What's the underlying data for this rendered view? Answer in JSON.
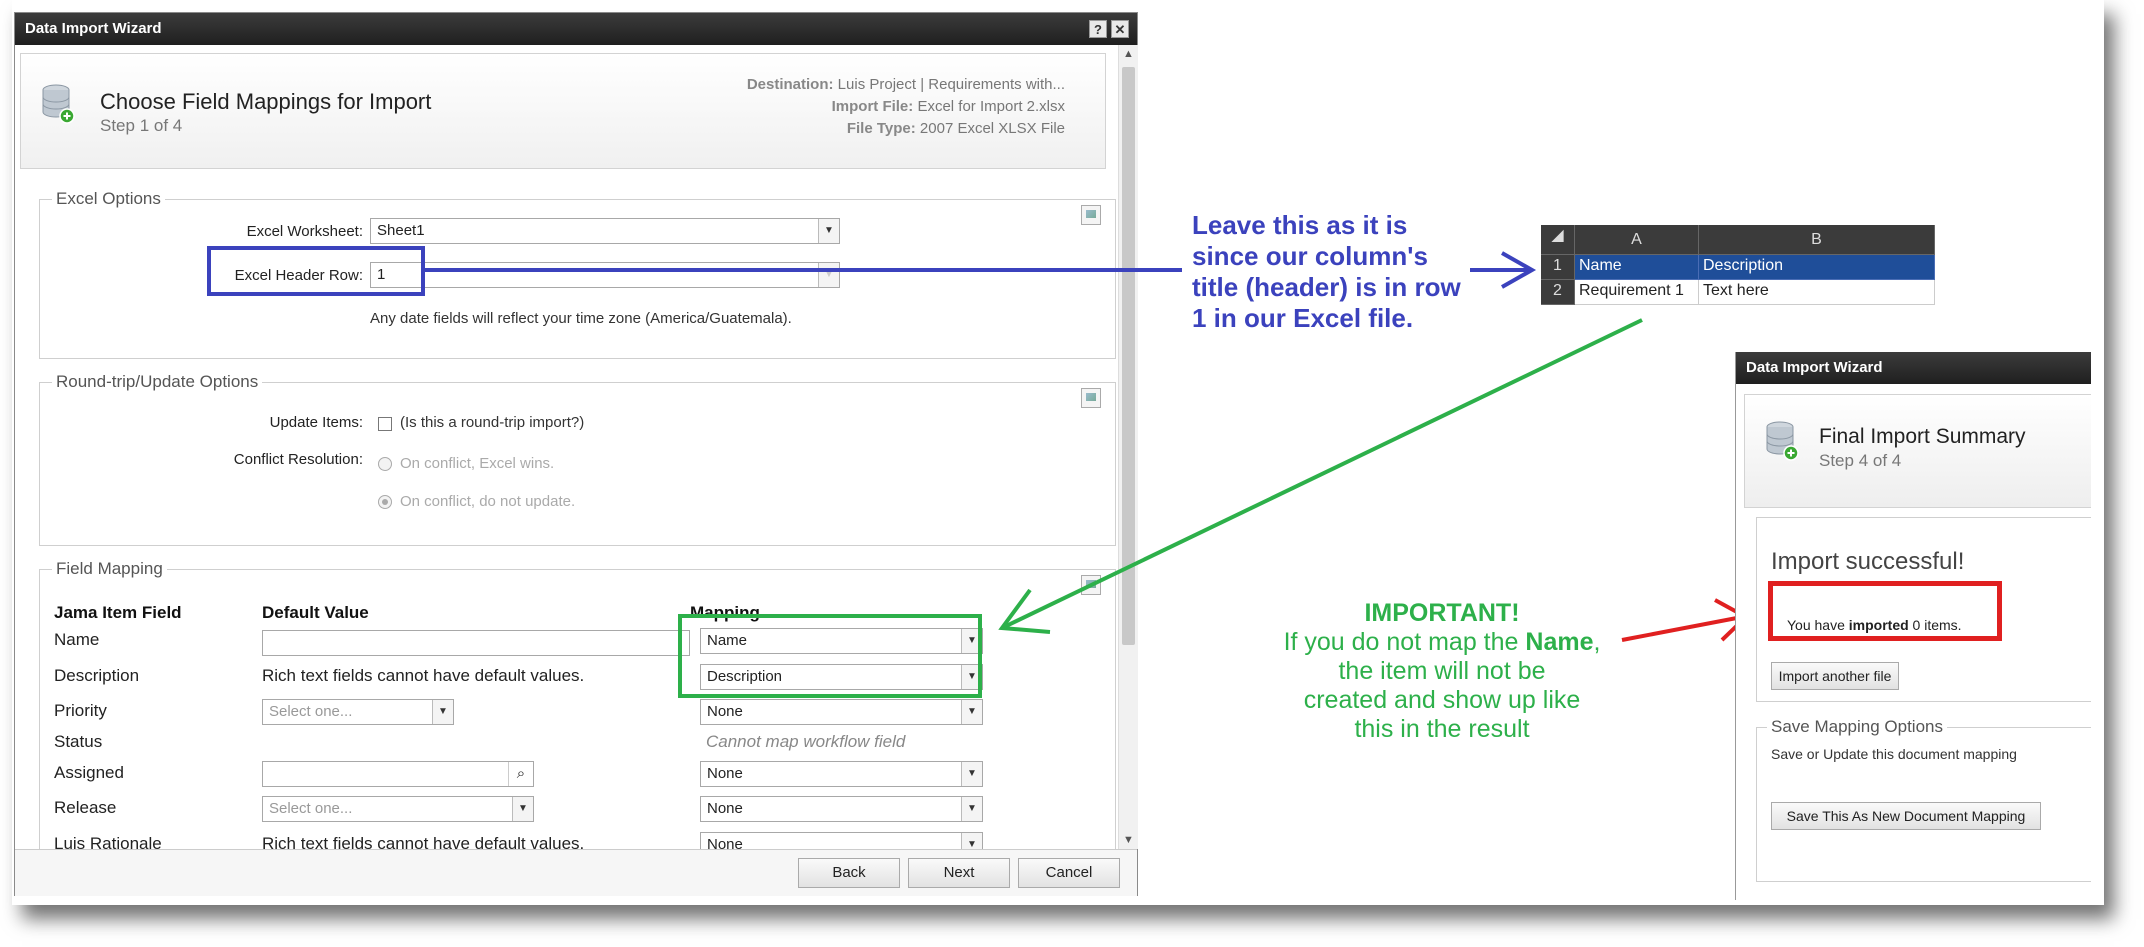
{
  "dialog": {
    "title": "Data Import Wizard",
    "help_label": "?",
    "close_label": "✕",
    "header": {
      "title": "Choose Field Mappings for Import",
      "step": "Step 1 of 4",
      "destination_label": "Destination:",
      "destination_value": "Luis Project | Requirements with...",
      "import_file_label": "Import File:",
      "import_file_value": "Excel for Import 2.xlsx",
      "file_type_label": "File Type:",
      "file_type_value": "2007 Excel XLSX File"
    },
    "excel_options": {
      "legend": "Excel Options",
      "worksheet_label": "Excel Worksheet:",
      "worksheet_value": "Sheet1",
      "header_row_label": "Excel Header Row:",
      "header_row_value": "1",
      "timezone_note": "Any date fields will reflect your time zone (America/Guatemala)."
    },
    "roundtrip": {
      "legend": "Round-trip/Update Options",
      "update_label": "Update Items:",
      "update_text": "(Is this a round-trip import?)",
      "conflict_label": "Conflict Resolution:",
      "option1": "On conflict, Excel wins.",
      "option2": "On conflict, do not update."
    },
    "field_mapping": {
      "legend": "Field Mapping",
      "col_field": "Jama Item Field",
      "col_default": "Default Value",
      "col_mapping": "Mapping",
      "rows": [
        {
          "field": "Name",
          "default": "",
          "mapping": "Name"
        },
        {
          "field": "Description",
          "default": "Rich text fields cannot have default values.",
          "mapping": "Description"
        },
        {
          "field": "Priority",
          "default": "Select one...",
          "mapping": "None"
        },
        {
          "field": "Status",
          "default": "",
          "mapping": "Cannot map workflow field"
        },
        {
          "field": "Assigned",
          "default": "",
          "mapping": "None"
        },
        {
          "field": "Release",
          "default": "Select one...",
          "mapping": "None"
        },
        {
          "field": "Luis Rationale",
          "default": "Rich text fields cannot have default values.",
          "mapping": "None"
        }
      ]
    },
    "buttons": {
      "back": "Back",
      "next": "Next",
      "cancel": "Cancel"
    }
  },
  "annotations": {
    "blue_text": [
      "Leave this as it is",
      "since our column's",
      "title (header) is in row",
      "1 in our Excel file."
    ],
    "important_title": "IMPORTANT!",
    "important_line1_pre": "If you do not map the ",
    "important_line1_bold": "Name",
    "important_line1_post": ",",
    "important_line2": "the item will not be",
    "important_line3": "created and show up like",
    "important_line4": "this in the result",
    "colors": {
      "blue": "#3b42bd",
      "green": "#2db04a",
      "red": "#e02020"
    }
  },
  "excel": {
    "columns": [
      "A",
      "B"
    ],
    "rows": [
      {
        "num": "1",
        "a": "Name",
        "b": "Description"
      },
      {
        "num": "2",
        "a": "Requirement 1",
        "b": "Text here"
      }
    ]
  },
  "dialog2": {
    "title": "Data Import Wizard",
    "header_title": "Final Import Summary",
    "header_step": "Step 4 of 4",
    "success": "Import successful!",
    "imported_pre": "You have ",
    "imported_bold": "imported",
    "imported_post": " 0 items.",
    "import_another": "Import another file",
    "save_legend": "Save Mapping Options",
    "save_note": "Save or Update this document mapping",
    "save_button": "Save This As New Document Mapping"
  }
}
